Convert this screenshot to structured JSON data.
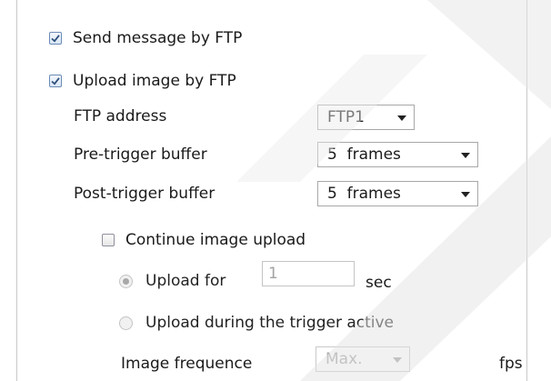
{
  "send_ftp": {
    "label": "Send message by FTP",
    "checked": true
  },
  "upload_ftp": {
    "label": "Upload image by FTP",
    "checked": true
  },
  "ftp_address": {
    "label": "FTP address",
    "value": "FTP1"
  },
  "pre_trigger": {
    "label": "Pre-trigger buffer",
    "value": "5  frames"
  },
  "post_trigger": {
    "label": "Post-trigger buffer",
    "value": "5  frames"
  },
  "continue_upload": {
    "label": "Continue image upload",
    "checked": false
  },
  "upload_for": {
    "label": "Upload for",
    "value": "1",
    "unit": "sec",
    "selected": true
  },
  "upload_during": {
    "label": "Upload during the trigger active",
    "selected": false
  },
  "image_frequence": {
    "label": "Image frequence",
    "value": "Max.",
    "unit": "fps"
  }
}
